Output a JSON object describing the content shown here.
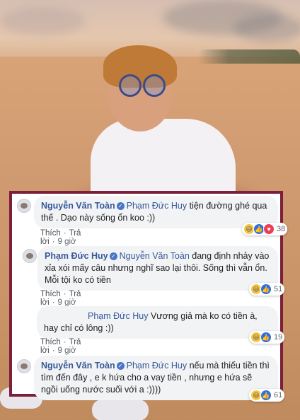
{
  "comments": [
    {
      "author": "Nguyễn Văn Toàn",
      "tagged": "Phạm Đức Huy",
      "text": " tiện đường ghé qua thế . Dạo này sống ổn koo :))",
      "like_label": "Thích",
      "reply_label": "Trả lời",
      "time": "9 giờ",
      "reactions": [
        "haha-icon",
        "like-icon",
        "love-icon"
      ],
      "reaction_count": "38"
    },
    {
      "author": "Phạm Đức Huy",
      "tagged": "Nguyễn Văn Toàn",
      "text": " đang định nhảy vào xỉa xói mấy câu nhưng nghĩ sao lại thôi. Sống thì vẫn ổn. Mỗi tội ko có tiền",
      "like_label": "Thích",
      "reply_label": "Trả lời",
      "time": "9 giờ",
      "reactions": [
        "haha-icon",
        "like-icon"
      ],
      "reaction_count": "51"
    },
    {
      "author": "",
      "tagged": "Phạm Đức Huy",
      "text": " Vương giả mà ko có tiền à, hay chỉ có lông :))",
      "like_label": "Thích",
      "reply_label": "Trả lời",
      "time": "9 giờ",
      "reactions": [
        "haha-icon",
        "like-icon"
      ],
      "reaction_count": "19"
    },
    {
      "author": "Nguyễn Văn Toàn",
      "tagged": "Phạm Đức Huy",
      "text": " nếu mà thiếu tiền thì tìm đến đây , e k hứa cho a vay tiền , nhưng e hứa sẽ ngồi uống nước suối với a :))))",
      "reactions": [
        "haha-icon",
        "like-icon"
      ],
      "reaction_count": "61"
    }
  ],
  "colors": {
    "frame": "#7b1f3a",
    "name": "#385898",
    "bubble": "#f2f3f5",
    "meta": "#606770"
  }
}
